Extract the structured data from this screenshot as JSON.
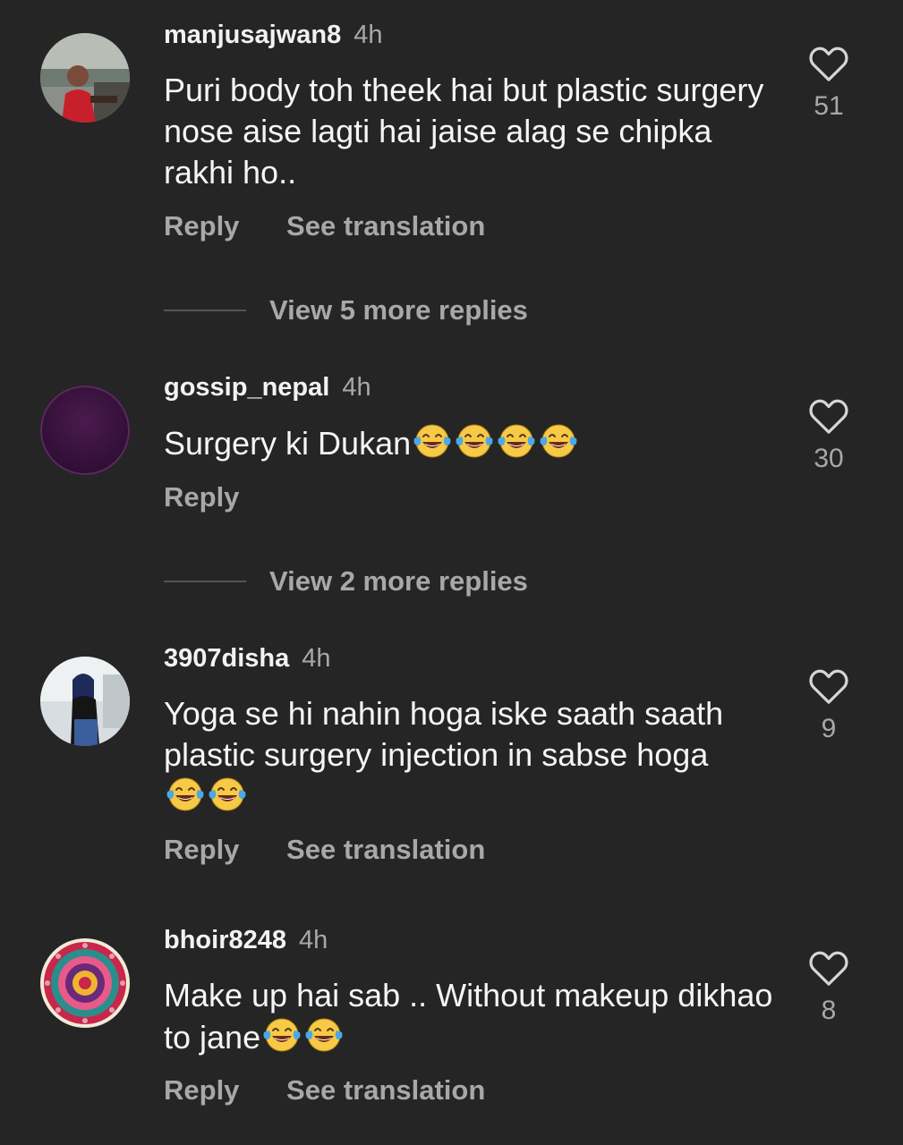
{
  "comments": [
    {
      "username": "manjusajwan8",
      "time": "4h",
      "text": "Puri body toh theek hai but  plastic surgery nose aise lagti hai jaise alag se chipka rakhi ho..",
      "emojis": [],
      "likes": "51",
      "reply_label": "Reply",
      "translate_label": "See translation",
      "avatar_icon": "profile-photo-woman-mall"
    },
    {
      "username": "gossip_nepal",
      "time": "4h",
      "text": "Surgery ki Dukan",
      "emojis": [
        "😂",
        "😂",
        "😂",
        "😂"
      ],
      "likes": "30",
      "reply_label": "Reply",
      "avatar_icon": "profile-photo-purple"
    },
    {
      "username": "3907disha",
      "time": "4h",
      "text": "Yoga se hi nahin hoga iske saath saath plastic surgery injection in sabse hoga",
      "emojis": [
        "😂",
        "😂"
      ],
      "likes": "9",
      "reply_label": "Reply",
      "translate_label": "See translation",
      "avatar_icon": "profile-photo-girl"
    },
    {
      "username": "bhoir8248",
      "time": "4h",
      "text": "Make up hai sab .. Without makeup dikhao to jane",
      "emojis": [
        "😂",
        "😂"
      ],
      "likes": "8",
      "reply_label": "Reply",
      "translate_label": "See translation",
      "avatar_icon": "profile-photo-mandala"
    }
  ],
  "view_replies": [
    {
      "label": "View 5 more replies"
    },
    {
      "label": "View 2 more replies"
    }
  ],
  "colors": {
    "background": "#252525",
    "primary_text": "#f2f2f2",
    "secondary_text": "#a8a8a8",
    "emoji_face": "#f7c948"
  }
}
